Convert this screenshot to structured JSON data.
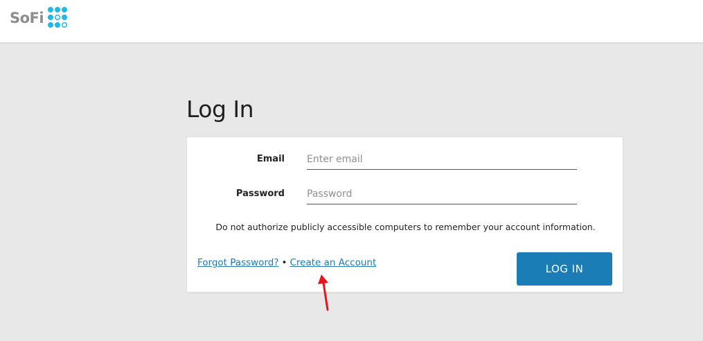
{
  "header": {
    "logo_text": "SoFi",
    "logo_icon": "sofi-dots-icon",
    "brand_color": "#21b8e8"
  },
  "page": {
    "title": "Log In"
  },
  "form": {
    "email_label": "Email",
    "email_placeholder": "Enter email",
    "email_value": "",
    "password_label": "Password",
    "password_placeholder": "Password",
    "password_value": "",
    "notice": "Do not authorize publicly accessible computers to remember your account information.",
    "forgot_link": "Forgot Password?",
    "separator": "•",
    "create_link": "Create an Account",
    "login_button": "LOG IN",
    "button_color": "#1a7db6",
    "link_color": "#1e7ab4"
  },
  "annotation": {
    "icon": "red-arrow-icon",
    "color": "#e8141c"
  }
}
